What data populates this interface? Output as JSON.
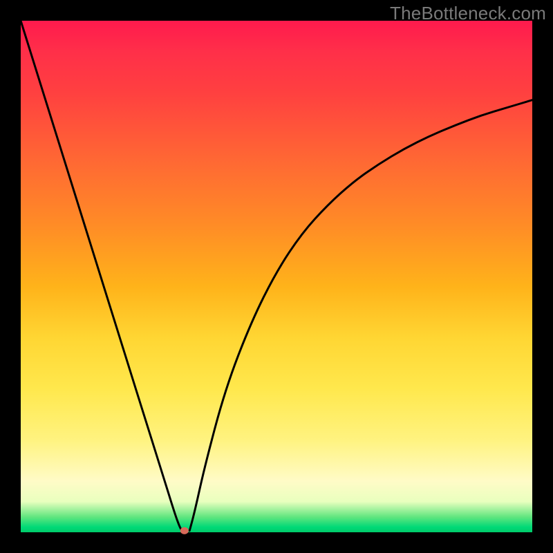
{
  "watermark": "TheBottleneck.com",
  "chart_data": {
    "type": "line",
    "title": "",
    "xlabel": "",
    "ylabel": "",
    "xlim": [
      0,
      100
    ],
    "ylim": [
      0,
      100
    ],
    "notes": "Axes and tick labels are not shown in the image; x and y are normalized 0–100. The curve is a V/funnel shape: a near-linear descending left branch meeting a right branch that rises with decreasing slope. Background is a vertical red→green gradient. A small red dot sits at the curve minimum.",
    "series": [
      {
        "name": "left-branch",
        "x": [
          0,
          5,
          10,
          15,
          20,
          25,
          28,
          30,
          31,
          31.5
        ],
        "y": [
          100,
          84,
          68,
          52,
          36,
          20,
          10.5,
          4,
          1.2,
          0.3
        ]
      },
      {
        "name": "right-branch",
        "x": [
          33,
          34,
          36,
          40,
          45,
          50,
          55,
          60,
          65,
          70,
          75,
          80,
          85,
          90,
          95,
          100
        ],
        "y": [
          0.3,
          4,
          13,
          28,
          41,
          51,
          58.5,
          64,
          68.5,
          72,
          75,
          77.5,
          79.6,
          81.5,
          83,
          84.5
        ]
      }
    ],
    "marker": {
      "x": 32,
      "y": 0.3,
      "color": "#d86a5a",
      "radius_px": 6
    }
  }
}
